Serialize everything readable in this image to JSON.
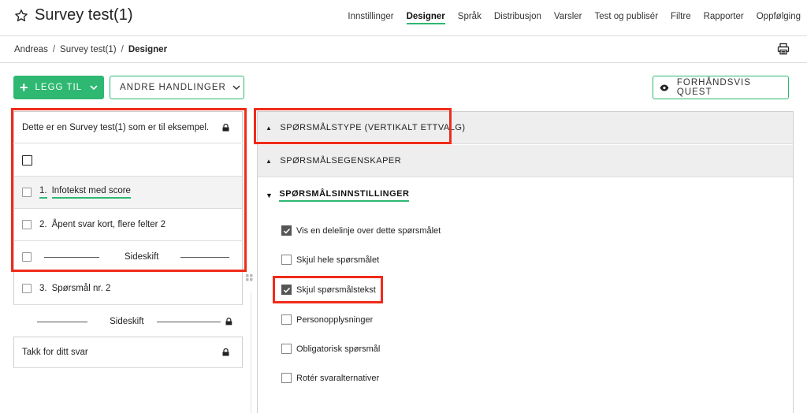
{
  "header": {
    "title": "Survey test(1)",
    "nav": [
      {
        "label": "Innstillinger",
        "active": false
      },
      {
        "label": "Designer",
        "active": true
      },
      {
        "label": "Språk",
        "active": false
      },
      {
        "label": "Distribusjon",
        "active": false
      },
      {
        "label": "Varsler",
        "active": false
      },
      {
        "label": "Test og publisér",
        "active": false
      },
      {
        "label": "Filtre",
        "active": false
      },
      {
        "label": "Rapporter",
        "active": false
      },
      {
        "label": "Oppfølging",
        "active": false
      }
    ]
  },
  "breadcrumb": {
    "items": [
      "Andreas",
      "Survey test(1)"
    ],
    "current": "Designer",
    "separator": "/"
  },
  "toolbar": {
    "add_label": "LEGG TIL",
    "other_label": "ANDRE HANDLINGER",
    "preview_label": "FORHÅNDSVIS QUEST"
  },
  "questions": {
    "intro": "Dette er en Survey test(1) som er til eksempel.",
    "items": [
      {
        "number": "1.",
        "label": "Infotekst med score"
      },
      {
        "number": "2.",
        "label": "Åpent svar kort, flere felter 2"
      },
      {
        "number": "3.",
        "label": "Spørsmål nr. 2"
      }
    ],
    "pagebreak_label": "Sideskift",
    "pagebreak2_label": "Sideskift",
    "end": "Takk for ditt svar"
  },
  "panel": {
    "type_header": "SPØRSMÅLSTYPE (VERTIKALT ETTVALG)",
    "props_header": "SPØRSMÅLSEGENSKAPER",
    "settings_header": "SPØRSMÅLSINNSTILLINGER",
    "options": [
      {
        "label": "Vis en delelinje over dette spørsmålet",
        "checked": true
      },
      {
        "label": "Skjul hele spørsmålet",
        "checked": false
      },
      {
        "label": "Skjul spørsmålstekst",
        "checked": true
      },
      {
        "label": "Personopplysninger",
        "checked": false
      },
      {
        "label": "Obligatorisk spørsmål",
        "checked": false
      },
      {
        "label": "Rotér svaralternativer",
        "checked": false
      }
    ]
  },
  "colors": {
    "accent": "#2eb872",
    "highlight": "#f02b1a",
    "panel_header_bg": "#eeeeee"
  }
}
